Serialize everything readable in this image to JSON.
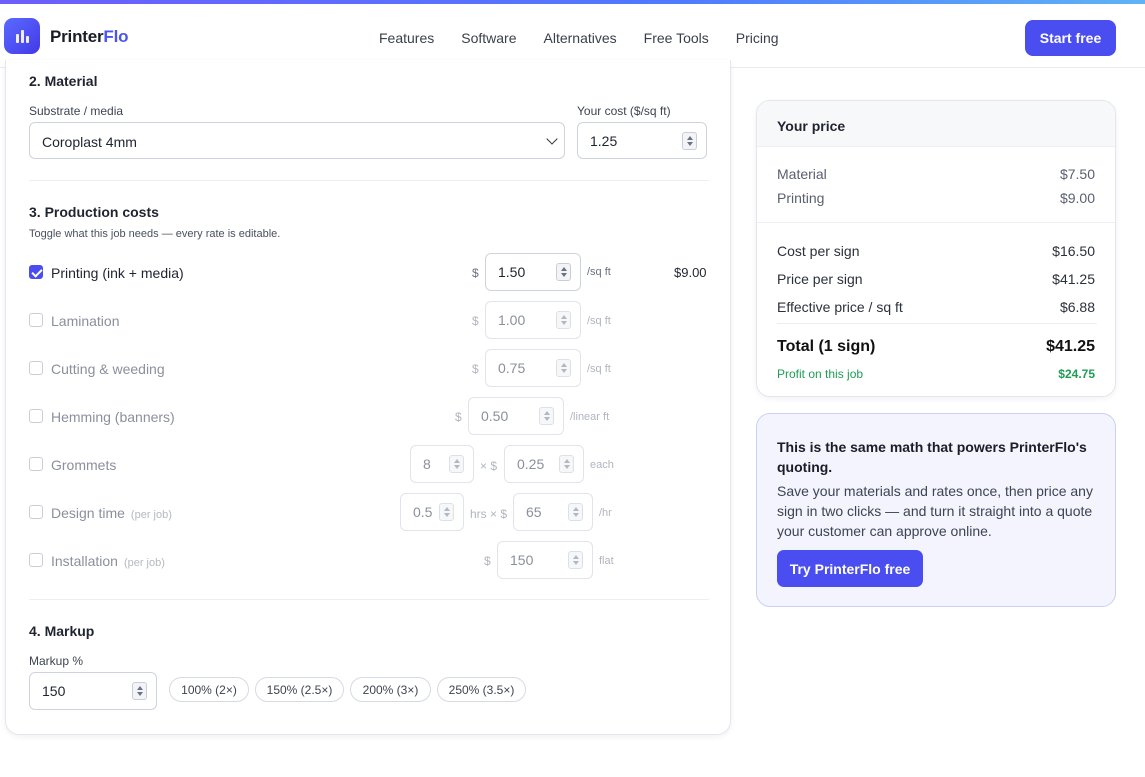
{
  "header": {
    "brand_part1": "Printer",
    "brand_part2": "Flo",
    "nav": [
      "Features",
      "Software",
      "Alternatives",
      "Free Tools",
      "Pricing"
    ],
    "cta": "Start free"
  },
  "material": {
    "heading": "2. Material",
    "substrate_label": "Substrate / media",
    "substrate_value": "Coroplast 4mm",
    "cost_label": "Your cost ($/sq ft)",
    "cost_value": "1.25"
  },
  "production": {
    "heading": "3. Production costs",
    "hint": "Toggle what this job needs — every rate is editable.",
    "printing": {
      "label": "Printing (ink + media)",
      "checked": true,
      "symbol": "$",
      "rate": "1.50",
      "unit": "/sq ft",
      "amount": "$9.00"
    },
    "lamination": {
      "label": "Lamination",
      "checked": false,
      "symbol": "$",
      "rate": "1.00",
      "unit": "/sq ft"
    },
    "cutting": {
      "label": "Cutting & weeding",
      "checked": false,
      "symbol": "$",
      "rate": "0.75",
      "unit": "/sq ft"
    },
    "hemming": {
      "label": "Hemming (banners)",
      "checked": false,
      "symbol": "$",
      "rate": "0.50",
      "unit": "/linear ft"
    },
    "grommets": {
      "label": "Grommets",
      "checked": false,
      "qty": "8",
      "mid": "× $",
      "rate": "0.25",
      "unit": "each"
    },
    "design": {
      "label": "Design time",
      "note": "(per job)",
      "checked": false,
      "qty": "0.5",
      "mid": "hrs × $",
      "rate": "65",
      "unit": "/hr"
    },
    "install": {
      "label": "Installation",
      "note": "(per job)",
      "checked": false,
      "symbol": "$",
      "rate": "150",
      "unit": "flat"
    }
  },
  "markup": {
    "heading": "4. Markup",
    "label": "Markup %",
    "value": "150",
    "presets": [
      "100% (2×)",
      "150% (2.5×)",
      "200% (3×)",
      "250% (3.5×)"
    ]
  },
  "price": {
    "heading": "Your price",
    "material_label": "Material",
    "material_value": "$7.50",
    "printing_label": "Printing",
    "printing_value": "$9.00",
    "cost_label": "Cost per sign",
    "cost_value": "$16.50",
    "price_label": "Price per sign",
    "price_value": "$41.25",
    "eff_label": "Effective price / sq ft",
    "eff_value": "$6.88",
    "total_label": "Total (1 sign)",
    "total_value": "$41.25",
    "profit_label": "Profit on this job",
    "profit_value": "$24.75"
  },
  "promo": {
    "title": "This is the same math that powers PrinterFlo's quoting.",
    "body": "Save your materials and rates once, then price any sign in two clicks — and turn it straight into a quote your customer can approve online.",
    "cta": "Try PrinterFlo free"
  },
  "colors": {
    "accent": "#4a4df0",
    "profit": "#1f9d55"
  }
}
